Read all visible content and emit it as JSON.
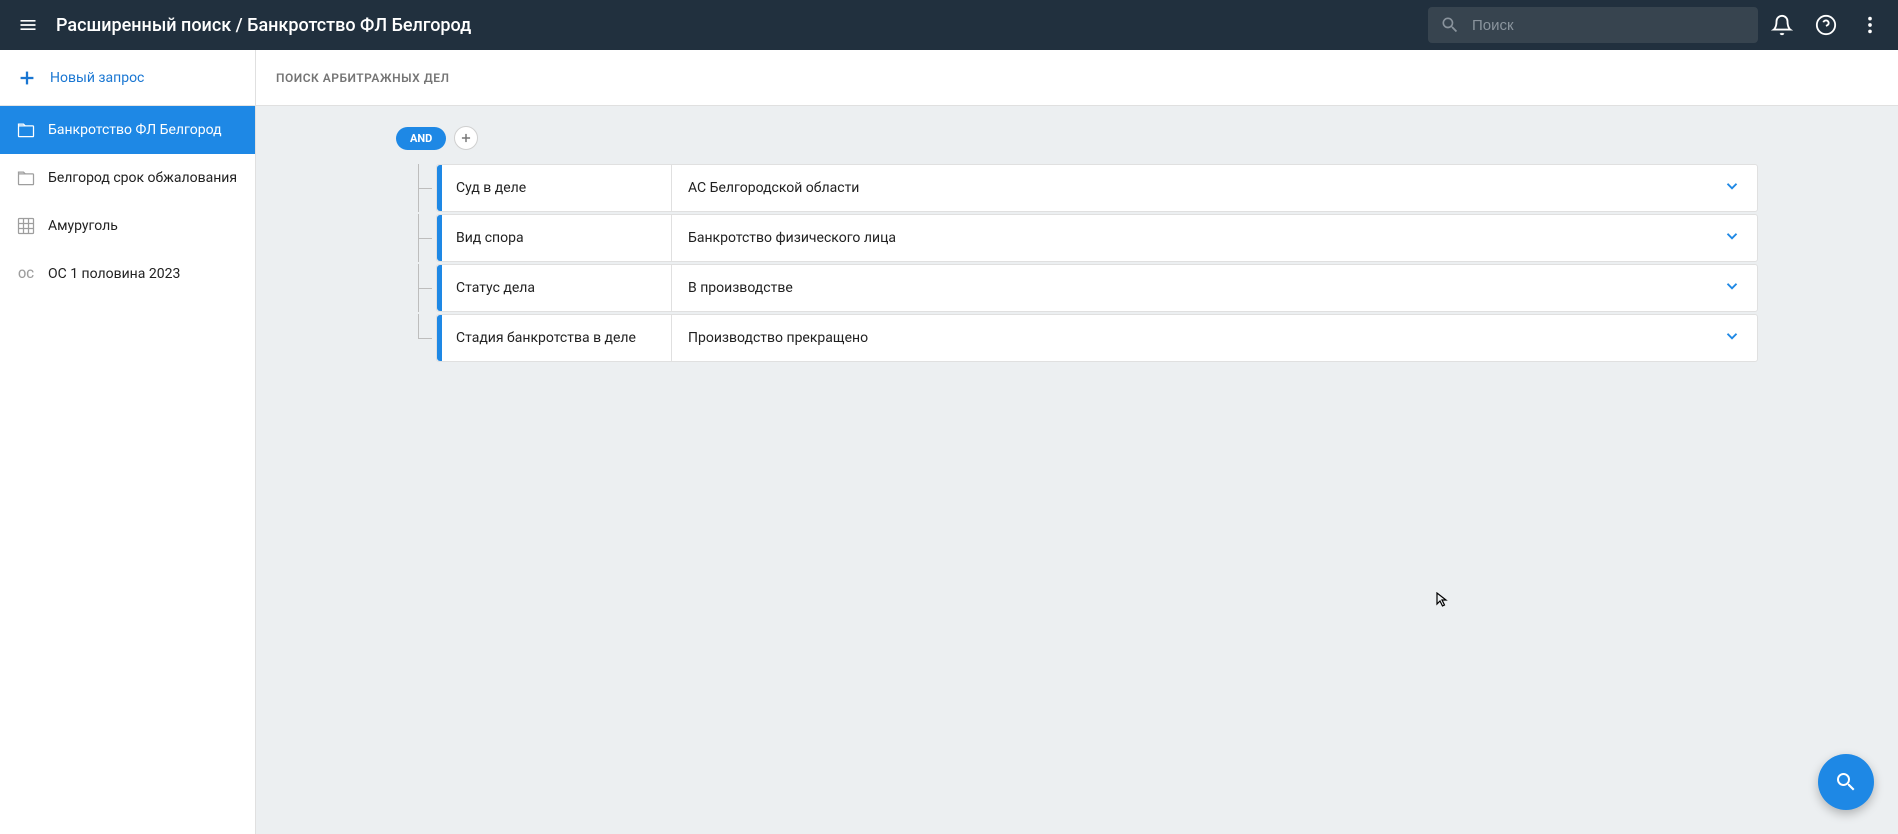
{
  "header": {
    "title": "Расширенный поиск / Банкротство ФЛ Белгород",
    "search_placeholder": "Поиск"
  },
  "sidebar": {
    "new_query_label": "Новый запрос",
    "items": [
      {
        "label": "Банкротство ФЛ Белгород",
        "icon": "folder",
        "active": true
      },
      {
        "label": "Белгород срок обжалования",
        "icon": "folder",
        "active": false
      },
      {
        "label": "Амуруголь",
        "icon": "grid",
        "active": false
      },
      {
        "label": "ОС 1 половина 2023",
        "icon": "oc",
        "active": false
      }
    ]
  },
  "main": {
    "header_title": "ПОИСК АРБИТРАЖНЫХ ДЕЛ",
    "operator": "AND",
    "conditions": [
      {
        "label": "Суд в деле",
        "value": "АС Белгородской области"
      },
      {
        "label": "Вид спора",
        "value": "Банкротство физического лица"
      },
      {
        "label": "Статус дела",
        "value": "В производстве"
      },
      {
        "label": "Стадия банкротства в деле",
        "value": "Производство прекращено"
      }
    ]
  }
}
